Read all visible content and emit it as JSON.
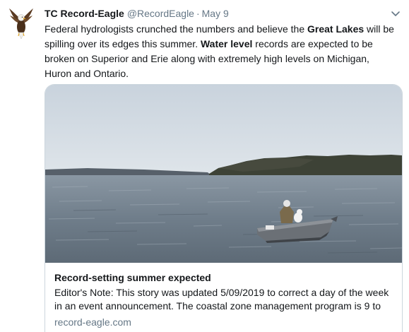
{
  "tweet": {
    "author_name": "TC Record-Eagle",
    "author_handle": "@RecordEagle",
    "separator": "·",
    "timestamp": "May 9",
    "text_segments": [
      {
        "text": "Federal hydrologists crunched the numbers and believe the ",
        "bold": false
      },
      {
        "text": "Great Lakes",
        "bold": true
      },
      {
        "text": " will be spilling over its edges this summer. ",
        "bold": false
      },
      {
        "text": "Water level",
        "bold": true
      },
      {
        "text": " records are expected to be broken on Superior and Erie along with extremely high levels on Michigan, Huron and Ontario.",
        "bold": false
      }
    ],
    "avatar_icon": "eagle-logo-icon",
    "menu_icon": "chevron-down-icon"
  },
  "card": {
    "image_icon": "lake-fisherman-photo",
    "title": "Record-setting summer expected",
    "description": "Editor's Note: This story was updated 5/09/2019 to correct a day of the week in an event announcement. The coastal zone management program is 9 to",
    "domain": "record-eagle.com"
  },
  "colors": {
    "text_primary": "#14171a",
    "text_secondary": "#657786",
    "border": "#ccd6dd"
  }
}
